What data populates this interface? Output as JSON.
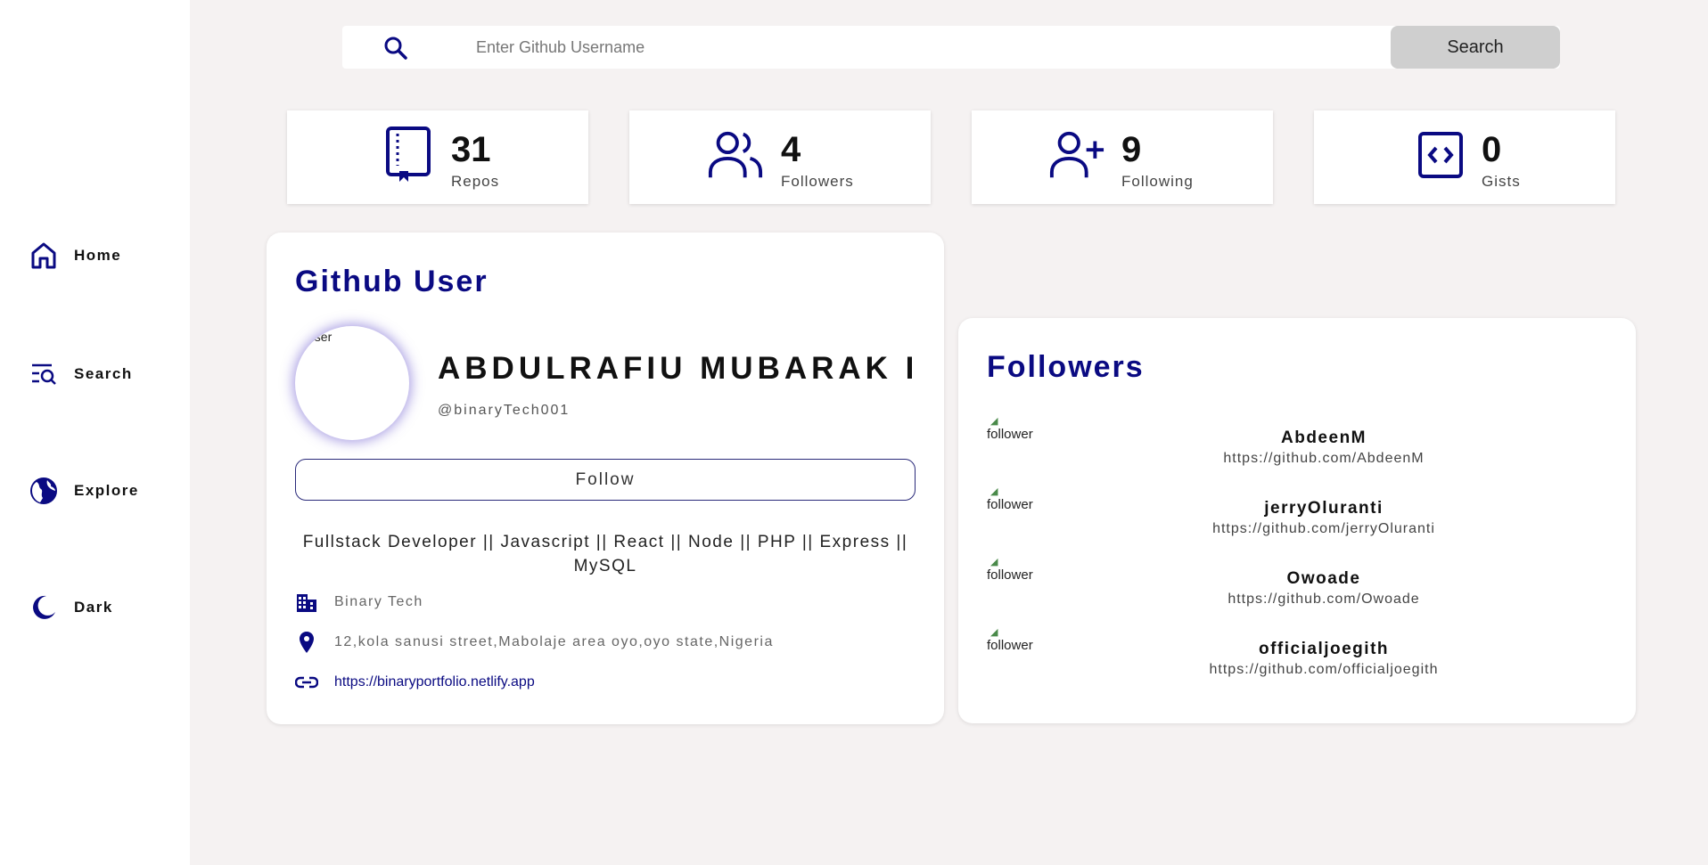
{
  "sidebar": {
    "items": [
      {
        "label": "Home",
        "icon": "home-icon"
      },
      {
        "label": "Search",
        "icon": "search-list-icon"
      },
      {
        "label": "Explore",
        "icon": "globe-icon"
      },
      {
        "label": "Dark",
        "icon": "moon-icon"
      }
    ]
  },
  "search": {
    "placeholder": "Enter Github Username",
    "value": "",
    "button_label": "Search"
  },
  "stats": [
    {
      "value": "31",
      "label": "Repos",
      "icon": "book-icon"
    },
    {
      "value": "4",
      "label": "Followers",
      "icon": "users-icon"
    },
    {
      "value": "9",
      "label": "Following",
      "icon": "user-plus-icon"
    },
    {
      "value": "0",
      "label": "Gists",
      "icon": "code-icon"
    }
  ],
  "user": {
    "card_title": "Github User",
    "avatar_alt": "user",
    "name": "ABDULRAFIU MUBARAK I",
    "handle": "@binaryTech001",
    "follow_label": "Follow",
    "bio": "Fullstack Developer || Javascript || React || Node || PHP || Express || MySQL",
    "company": "Binary Tech",
    "location": "12,kola sanusi street,Mabolaje area oyo,oyo state,Nigeria",
    "blog": "https://binaryportfolio.netlify.app"
  },
  "followers": {
    "title": "Followers",
    "img_alt": "follower",
    "list": [
      {
        "login": "AbdeenM",
        "url": "https://github.com/AbdeenM"
      },
      {
        "login": "jerryOluranti",
        "url": "https://github.com/jerryOluranti"
      },
      {
        "login": "Owoade",
        "url": "https://github.com/Owoade"
      },
      {
        "login": "officialjoegith",
        "url": "https://github.com/officialjoegith"
      }
    ]
  },
  "colors": {
    "accent": "#0a0a82",
    "background": "#f5f2f2",
    "button_gray": "#cfcfcf"
  }
}
